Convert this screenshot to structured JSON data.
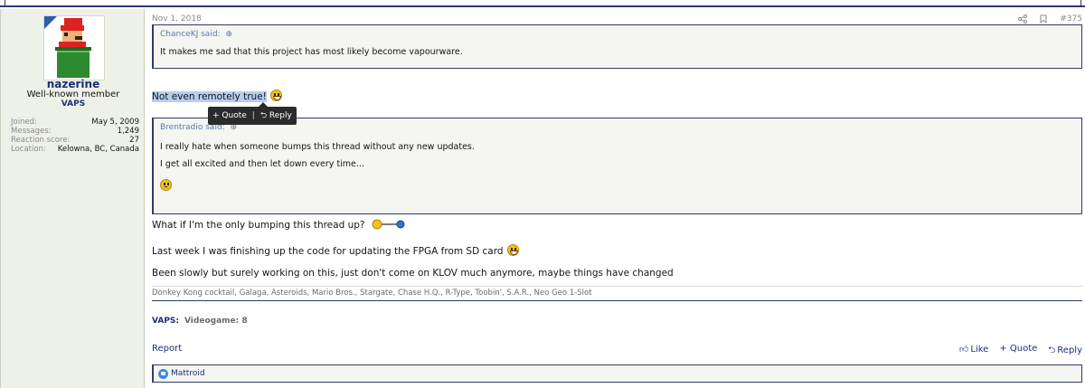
{
  "post": {
    "date": "Nov 1, 2018",
    "number": "#375",
    "user": {
      "name": "nazerine",
      "title": "Well-known member",
      "banner": "VAPS",
      "stats": [
        {
          "label": "Joined:",
          "value": "May 5, 2009"
        },
        {
          "label": "Messages:",
          "value": "1,249"
        },
        {
          "label": "Reaction score:",
          "value": "27"
        },
        {
          "label": "Location:",
          "value": "Kelowna, BC, Canada"
        }
      ]
    },
    "quote1": {
      "author": "ChanceKJ said:",
      "text": "It makes me sad that this project has most likely become vapourware."
    },
    "highlighted_text": "Not even remotely true!",
    "tooltip": {
      "quote": "+ Quote",
      "separator": "|",
      "reply": "Reply"
    },
    "quote2": {
      "author": "Brentradio said:",
      "line1": "I really hate when someone bumps this thread without any new updates.",
      "line2": "I get all excited and then let down every time..."
    },
    "para1": "What if I'm the only bumping this thread up?",
    "para2": "Last week I was finishing up the code for updating the FPGA from SD card",
    "para3": "Been slowly but surely working on this, just don't come on KLOV much anymore, maybe things have changed",
    "signature": "Donkey Kong cocktail, Galaga, Asteroids, Mario Bros., Stargate, Chase H.Q., R-Type, Toobin', S.A.R., Neo Geo 1-Slot",
    "vaps_label": "VAPS:",
    "vaps_value": "Videogame: 8",
    "report": "Report",
    "actions": {
      "like": "Like",
      "quote": "+ Quote",
      "reply": "Reply"
    },
    "reaction_user": "Mattroid"
  }
}
